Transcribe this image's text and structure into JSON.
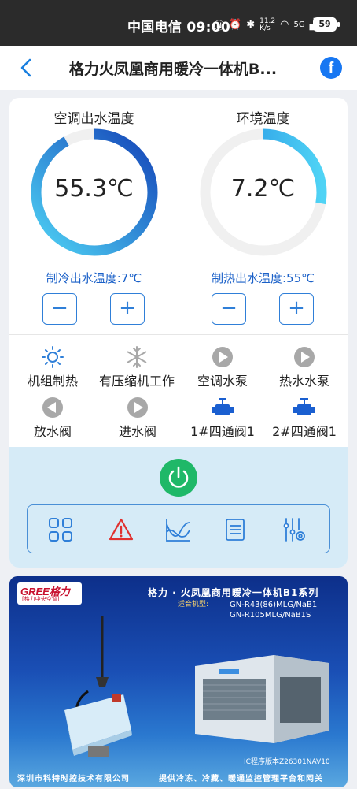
{
  "status_bar": {
    "carrier_time": "中国电信 09:00",
    "speed": "11.2 K/s",
    "network": "5G",
    "battery": "59"
  },
  "header": {
    "title": "格力火凤凰商用暖冷一体机B...",
    "back_icon": "chevron-left-icon",
    "share_icon": "facebook-icon"
  },
  "gauges": [
    {
      "title": "空调出水温度",
      "value_text": "55.3℃",
      "fill_fraction": 0.92,
      "setpoint_text": "制冷出水温度:7℃",
      "minus": "−",
      "plus": "+"
    },
    {
      "title": "环境温度",
      "value_text": "7.2℃",
      "fill_fraction": 0.28,
      "setpoint_text": "制热出水温度:55℃",
      "minus": "−",
      "plus": "+"
    }
  ],
  "status_items": [
    {
      "label": "机组制热",
      "icon": "sun-icon",
      "active": true
    },
    {
      "label": "有压缩机工作",
      "icon": "snowflake-icon",
      "active": false
    },
    {
      "label": "空调水泵",
      "icon": "play-icon",
      "active": false
    },
    {
      "label": "热水水泵",
      "icon": "play-icon",
      "active": false
    },
    {
      "label": "放水阀",
      "icon": "play-left-icon",
      "active": false
    },
    {
      "label": "进水阀",
      "icon": "play-icon",
      "active": false
    },
    {
      "label": "1#四通阀1",
      "icon": "valve-icon",
      "active": true
    },
    {
      "label": "2#四通阀1",
      "icon": "valve-icon",
      "active": true
    }
  ],
  "controls": {
    "power_icon": "power-icon",
    "toolbar": [
      "grid-icon",
      "warning-icon",
      "chart-icon",
      "list-icon",
      "settings-sliders-icon"
    ]
  },
  "banner": {
    "brand": "GREE格力",
    "brand_sub": "[格力中央空调]",
    "title": "格力 · 火凤凰商用暖冷一体机B1系列",
    "models_label": "适合机型:",
    "model_1": "GN-R43(86)MLG/NaB1",
    "model_2": "GN-R105MLG/NaB1S",
    "version": "IC程序版本Z26301NAV10",
    "company": "深圳市科特时控技术有限公司",
    "slogan": "提供冷冻、冷藏、暖通监控管理平台和网关"
  },
  "colors": {
    "accent_blue": "#1a60c8",
    "gauge_light": "#4fd3f5",
    "power_green": "#1fb868",
    "warning_red": "#e0312f"
  }
}
